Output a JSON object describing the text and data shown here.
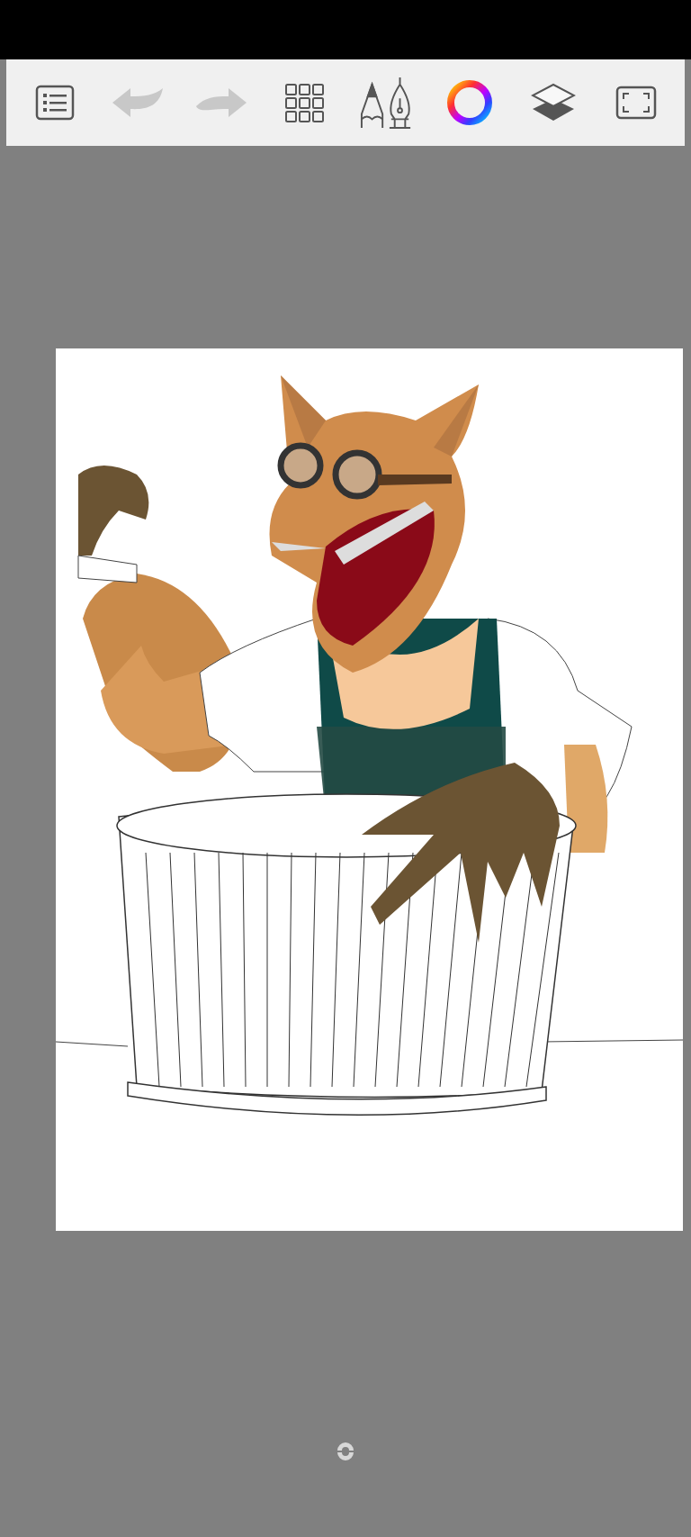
{
  "toolbar": {
    "items": [
      {
        "kind": "menu",
        "disabled": false
      },
      {
        "kind": "undo",
        "disabled": true
      },
      {
        "kind": "redo",
        "disabled": true
      },
      {
        "kind": "grid",
        "disabled": false
      },
      {
        "kind": "brush",
        "disabled": false
      },
      {
        "kind": "color",
        "disabled": false
      },
      {
        "kind": "layers",
        "disabled": false
      },
      {
        "kind": "fullscreen",
        "disabled": false
      }
    ]
  }
}
